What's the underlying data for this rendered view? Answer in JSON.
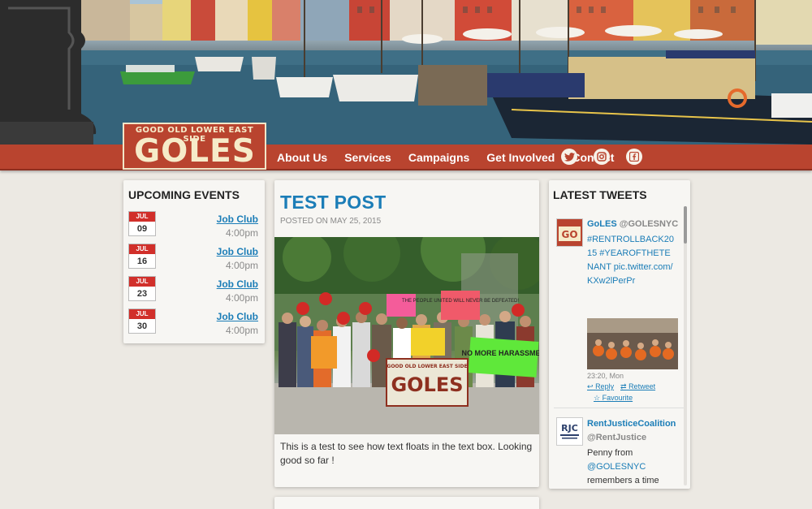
{
  "logo": {
    "tagline": "GOOD OLD LOWER EAST SIDE",
    "word": "GOLES"
  },
  "nav": {
    "items": [
      "About Us",
      "Services",
      "Campaigns",
      "Get Involved",
      "Contact"
    ],
    "social": [
      "twitter-icon",
      "instagram-icon",
      "facebook-icon"
    ]
  },
  "events": {
    "title": "UPCOMING EVENTS",
    "items": [
      {
        "month": "JUL",
        "day": "09",
        "title": "Job Club",
        "time": "4:00pm"
      },
      {
        "month": "JUL",
        "day": "16",
        "title": "Job Club",
        "time": "4:00pm"
      },
      {
        "month": "JUL",
        "day": "23",
        "title": "Job Club",
        "time": "4:00pm"
      },
      {
        "month": "JUL",
        "day": "30",
        "title": "Job Club",
        "time": "4:00pm"
      }
    ]
  },
  "post": {
    "title": "TEST POST",
    "meta": "POSTED ON MAY 25, 2015",
    "body": "This is a test to see how text floats in the text box. Looking good so far !",
    "banner_top": "GOOD OLD LOWER EAST SIDE",
    "banner_word": "GOLES",
    "sign_left": "THE PEOPLE UNITED WILL NEVER BE DEFEATED!",
    "sign_right": "NO MORE HARASSMENT"
  },
  "tweets": {
    "title": "LATEST TWEETS",
    "items": [
      {
        "name": "GoLES",
        "handle": "@GOLESNYC",
        "text": "#RENTROLLBACK2015 #YEAROFTHETENANT pic.twitter.com/KXw2lPerPr",
        "time": "23:20, Mon",
        "actions": [
          "Reply",
          "Retweet",
          "Favourite"
        ]
      },
      {
        "name": "RentJusticeCoalition",
        "handle": "@RentJustice",
        "text_before": "Penny from",
        "mention": "@GOLESNYC",
        "text_after": "remembers a time"
      }
    ]
  },
  "colors": {
    "brand_red": "#b9442f",
    "link_blue": "#1b7db7",
    "calendar_red": "#d12f2a"
  }
}
